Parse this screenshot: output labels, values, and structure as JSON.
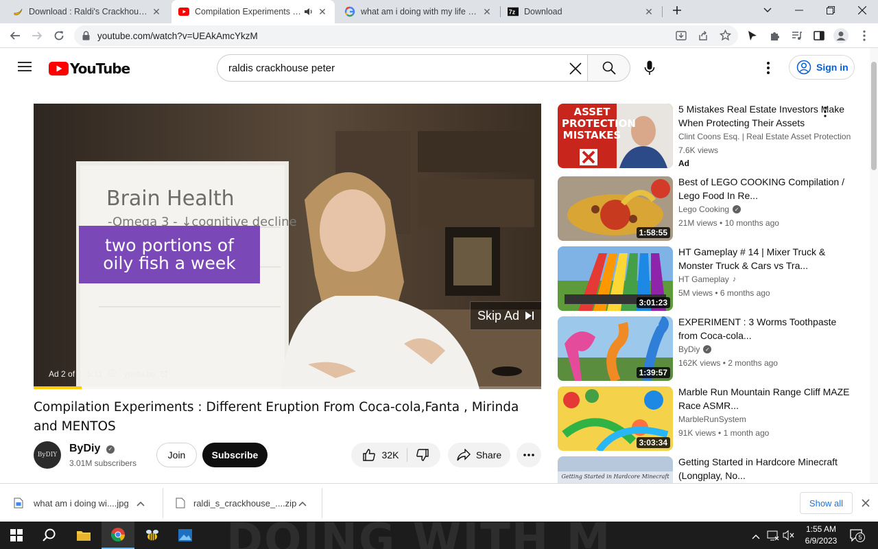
{
  "browser": {
    "tabs": [
      {
        "title": "Download : Raldi's Crackhouse [B",
        "icon": "banana-icon",
        "active": false
      },
      {
        "title": "Compilation Experiments : D",
        "icon": "youtube-icon",
        "active": true,
        "muted_icon": "speaker-icon"
      },
      {
        "title": "what am i doing with my life mem",
        "icon": "google-icon",
        "active": false
      },
      {
        "title": "Download",
        "icon": "7zip-icon",
        "active": false
      }
    ],
    "url": "youtube.com/watch?v=UEAkAmcYkzM"
  },
  "youtube": {
    "logo_text": "YouTube",
    "search_value": "raldis crackhouse peter",
    "signin_label": "Sign in"
  },
  "player": {
    "overlay_line1": "two portions of",
    "overlay_line2": "oily fish a week",
    "whiteboard_line1": "Brain Health",
    "whiteboard_line2": "-Omega 3 - ↓cognitive decline",
    "skip_label": "Skip Ad",
    "ad_label": "Ad 2 of 2",
    "ad_time": "5:11",
    "ad_domain": "youtu.be",
    "progress": 0.095,
    "accent": "#ffcc00"
  },
  "video": {
    "title": "Compilation Experiments : Different Eruption From Coca-cola,Fanta , Mirinda and MENTOS",
    "channel": "ByDiy",
    "avatar_text": "ByDIY",
    "subscribers": "3.01M subscribers",
    "join_label": "Join",
    "subscribe_label": "Subscribe",
    "likes": "32K",
    "share_label": "Share"
  },
  "recommendations": [
    {
      "title": "5 Mistakes Real Estate Investors Make When Protecting Their Assets",
      "channel": "Clint Coons Esq. | Real Estate Asset Protection",
      "views": "7.6K views",
      "age": "",
      "duration": "",
      "ad": "Ad",
      "thumb_text": "ASSET PROTECTION MISTAKES"
    },
    {
      "title": "Best of LEGO COOKING Compilation / Lego Food In Re...",
      "channel": "Lego Cooking",
      "views": "21M views",
      "age": "10 months ago",
      "duration": "1:58:55",
      "verified": true
    },
    {
      "title": "HT Gameplay # 14 | Mixer Truck & Monster Truck & Cars vs Tra...",
      "channel": "HT Gameplay",
      "views": "5M views",
      "age": "6 months ago",
      "duration": "3:01:23",
      "music": true
    },
    {
      "title": "EXPERIMENT : 3 Worms Toothpaste from Coca-cola...",
      "channel": "ByDiy",
      "views": "162K views",
      "age": "2 months ago",
      "duration": "1:39:57",
      "verified": true
    },
    {
      "title": "Marble Run Mountain Range Cliff MAZE Race ASMR...",
      "channel": "MarbleRunSystem",
      "views": "91K views",
      "age": "1 month ago",
      "duration": "3:03:34"
    },
    {
      "title": "Getting Started in Hardcore Minecraft (Longplay, No...",
      "channel": "",
      "views": "",
      "age": "",
      "duration": "",
      "thumb_text": "Getting Started in Hardcore Minecraft"
    }
  ],
  "downloads": [
    {
      "name": "what am i doing wi....jpg"
    },
    {
      "name": "raldi_s_crackhouse_....zip"
    }
  ],
  "downloads_showall": "Show all",
  "taskbar": {
    "time": "1:55 AM",
    "date": "6/9/2023",
    "wallpaper_text": "DOING WITH M",
    "notif_count": "5"
  }
}
